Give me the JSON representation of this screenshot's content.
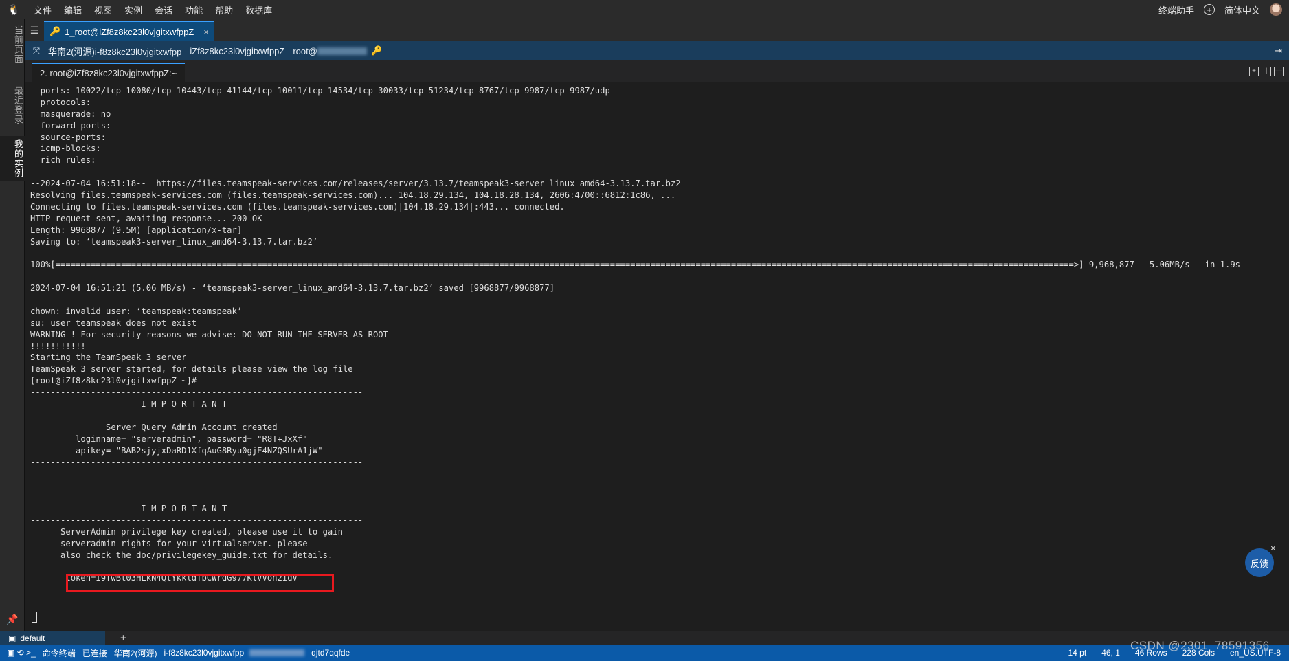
{
  "menubar": {
    "logo_icon": "linux-penguin-icon",
    "items": [
      "文件",
      "编辑",
      "视图",
      "实例",
      "会话",
      "功能",
      "帮助",
      "数据库"
    ],
    "assistant": "终端助手",
    "language": "简体中文"
  },
  "sidebar": {
    "tabs": [
      "当前页面",
      "最近登录",
      "我的实例"
    ]
  },
  "session_tab": {
    "label": "1_root@iZf8z8kc23l0vjgitxwfppZ",
    "close": "×"
  },
  "infobar": {
    "region": "华南2(河源)i-f8z8kc23l0vjgitxwfpp",
    "host": "iZf8z8kc23l0vjgitxwfppZ",
    "user": "root@"
  },
  "terminal_tab": {
    "label": "2. root@iZf8z8kc23l0vjgitxwfppZ:~"
  },
  "terminal": {
    "lines": [
      "  ports: 10022/tcp 10080/tcp 10443/tcp 41144/tcp 10011/tcp 14534/tcp 30033/tcp 51234/tcp 8767/tcp 9987/tcp 9987/udp",
      "  protocols:",
      "  masquerade: no",
      "  forward-ports:",
      "  source-ports:",
      "  icmp-blocks:",
      "  rich rules:",
      "",
      "--2024-07-04 16:51:18--  https://files.teamspeak-services.com/releases/server/3.13.7/teamspeak3-server_linux_amd64-3.13.7.tar.bz2",
      "Resolving files.teamspeak-services.com (files.teamspeak-services.com)... 104.18.29.134, 104.18.28.134, 2606:4700::6812:1c86, ...",
      "Connecting to files.teamspeak-services.com (files.teamspeak-services.com)|104.18.29.134|:443... connected.",
      "HTTP request sent, awaiting response... 200 OK",
      "Length: 9968877 (9.5M) [application/x-tar]",
      "Saving to: ‘teamspeak3-server_linux_amd64-3.13.7.tar.bz2’",
      "",
      "100%[==========================================================================================================================================================================================================>] 9,968,877   5.06MB/s   in 1.9s",
      "",
      "2024-07-04 16:51:21 (5.06 MB/s) - ‘teamspeak3-server_linux_amd64-3.13.7.tar.bz2’ saved [9968877/9968877]",
      "",
      "chown: invalid user: ‘teamspeak:teamspeak’",
      "su: user teamspeak does not exist",
      "WARNING ! For security reasons we advise: DO NOT RUN THE SERVER AS ROOT",
      "!!!!!!!!!!!",
      "Starting the TeamSpeak 3 server",
      "TeamSpeak 3 server started, for details please view the log file",
      "[root@iZf8z8kc23l0vjgitxwfppZ ~]#",
      "------------------------------------------------------------------",
      "                      I M P O R T A N T",
      "------------------------------------------------------------------",
      "               Server Query Admin Account created",
      "         loginname= \"serveradmin\", password= \"R8T+JxXf\"",
      "         apikey= \"BAB2sjyjxDaRD1XfqAuG8Ryu0gjE4NZQSUrA1jW\"",
      "------------------------------------------------------------------",
      "",
      "",
      "------------------------------------------------------------------",
      "                      I M P O R T A N T",
      "------------------------------------------------------------------",
      "      ServerAdmin privilege key created, please use it to gain",
      "      serveradmin rights for your virtualserver. please",
      "      also check the doc/privilegekey_guide.txt for details.",
      "",
      "       token=I9fwBt03HLkN4QtYkkldTbCWrdG977KlVVoh2idV",
      "------------------------------------------------------------------",
      "",
      ""
    ]
  },
  "feedback": {
    "label": "反馈",
    "close": "×"
  },
  "profile": {
    "label": "default",
    "add": "+"
  },
  "statusbar": {
    "left": [
      "命令终端",
      "已连接",
      "华南2(河源)",
      "i-f8z8kc23l0vjgitxwfpp"
    ],
    "suffix": "qjtd7qqfde",
    "right": [
      "14 pt",
      "46, 1",
      "46 Rows",
      "228 Cols",
      "en_US.UTF-8"
    ]
  },
  "watermark": "CSDN @2301_78591356"
}
